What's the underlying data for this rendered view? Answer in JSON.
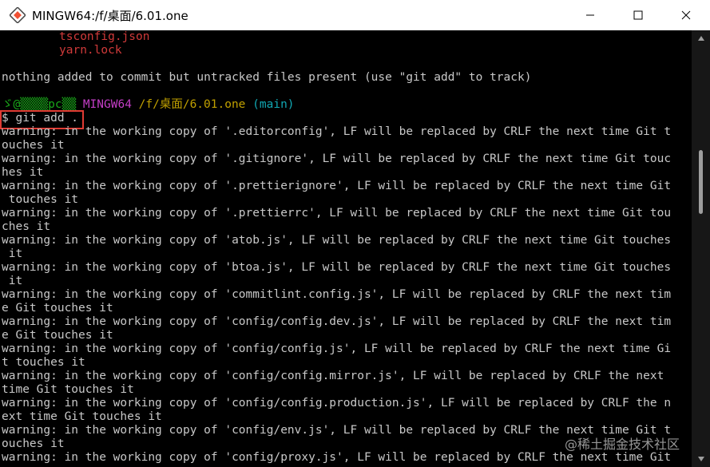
{
  "window": {
    "title": "MINGW64:/f/桌面/6.01.one",
    "icon": "git-bash-icon",
    "controls": [
      "minimize-icon",
      "maximize-icon",
      "close-icon"
    ]
  },
  "terminal": {
    "untracked_files": [
      "tsconfig.json",
      "yarn.lock"
    ],
    "status_message": "nothing added to commit but untracked files present (use \"git add\" to track)",
    "prompt": {
      "user_host": "ゞ@▒▒▒▒pc▒▒",
      "shell": "MINGW64",
      "path": "/f/桌面/6.01.one",
      "branch": "(main)"
    },
    "command": "$ git add .",
    "output_lines": [
      "warning: in the working copy of '.editorconfig', LF will be replaced by CRLF the next time Git t",
      "ouches it",
      "warning: in the working copy of '.gitignore', LF will be replaced by CRLF the next time Git touc",
      "hes it",
      "warning: in the working copy of '.prettierignore', LF will be replaced by CRLF the next time Git",
      " touches it",
      "warning: in the working copy of '.prettierrc', LF will be replaced by CRLF the next time Git tou",
      "ches it",
      "warning: in the working copy of 'atob.js', LF will be replaced by CRLF the next time Git touches",
      " it",
      "warning: in the working copy of 'btoa.js', LF will be replaced by CRLF the next time Git touches",
      " it",
      "warning: in the working copy of 'commitlint.config.js', LF will be replaced by CRLF the next tim",
      "e Git touches it",
      "warning: in the working copy of 'config/config.dev.js', LF will be replaced by CRLF the next tim",
      "e Git touches it",
      "warning: in the working copy of 'config/config.js', LF will be replaced by CRLF the next time Gi",
      "t touches it",
      "warning: in the working copy of 'config/config.mirror.js', LF will be replaced by CRLF the next",
      "time Git touches it",
      "warning: in the working copy of 'config/config.production.js', LF will be replaced by CRLF the n",
      "ext time Git touches it",
      "warning: in the working copy of 'config/env.js', LF will be replaced by CRLF the next time Git t",
      "ouches it",
      "warning: in the working copy of 'config/proxy.js', LF will be replaced by CRLF the next time Git"
    ]
  },
  "watermark": "@稀土掘金技术社区",
  "colors": {
    "untracked": "#d13a3a",
    "user_host": "#19a819",
    "shell": "#c33ec6",
    "path": "#c0a000",
    "branch": "#11a8b4",
    "highlight_border": "#e03b33"
  }
}
